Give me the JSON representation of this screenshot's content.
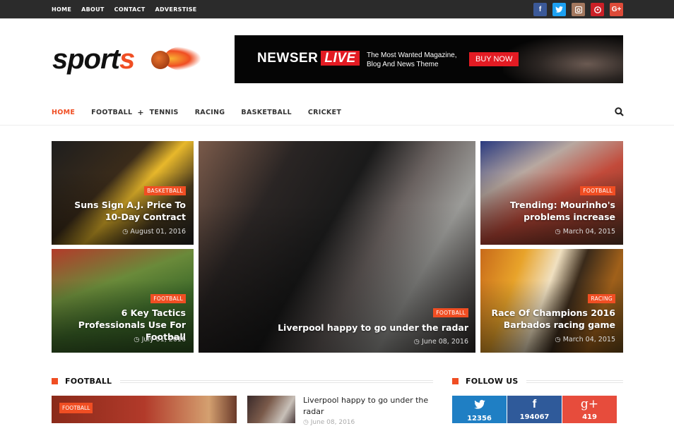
{
  "topbar": {
    "links": [
      "HOME",
      "ABOUT",
      "CONTACT",
      "ADVERSTISE"
    ],
    "social": [
      {
        "name": "facebook",
        "glyph": "f",
        "color": "#3b5998"
      },
      {
        "name": "twitter",
        "glyph": "t",
        "color": "#1da1f2"
      },
      {
        "name": "instagram",
        "glyph": "◘",
        "color": "#a3785f"
      },
      {
        "name": "pinterest",
        "glyph": "P",
        "color": "#cb2027"
      },
      {
        "name": "google-plus",
        "glyph": "G+",
        "color": "#dd4b39"
      }
    ]
  },
  "logo": {
    "text_main": "sport",
    "text_accent": "s"
  },
  "banner": {
    "brand": "NEWSER",
    "brand_accent": "LIVE",
    "tagline_1": "The Most Wanted Magazine,",
    "tagline_2": "Blog And News Theme",
    "cta": "BUY NOW"
  },
  "mainnav": {
    "items": [
      "HOME",
      "FOOTBALL",
      "TENNIS",
      "RACING",
      "BASKETBALL",
      "CRICKET"
    ],
    "active": "HOME",
    "submenu_indicator": "+"
  },
  "featured": [
    {
      "category": "BASKETBALL",
      "title": "Suns Sign A.J. Price To 10-Day Contract",
      "date": "August 01, 2016"
    },
    {
      "category": "FOOTBALL",
      "title": "6 Key Tactics Professionals Use For Football",
      "date": "July 01, 2016"
    },
    {
      "category": "FOOTBALL",
      "title": "Liverpool happy to go under the radar",
      "date": "June 08, 2016"
    },
    {
      "category": "FOOTBALL",
      "title": "Trending: Mourinho's problems increase",
      "date": "March 04, 2015"
    },
    {
      "category": "RACING",
      "title": "Race Of Champions 2016 Barbados racing game",
      "date": "March 04, 2015"
    }
  ],
  "football_section": {
    "title": "FOOTBALL",
    "big_post_category": "FOOTBALL",
    "list": [
      {
        "title": "Liverpool happy to go under the radar",
        "date": "June 08, 2016"
      }
    ]
  },
  "follow_section": {
    "title": "FOLLOW US",
    "networks": [
      {
        "name": "twitter",
        "glyph": "🐦",
        "count": "12356",
        "color": "#1f7fc4"
      },
      {
        "name": "facebook",
        "glyph": "f",
        "count": "194067",
        "color": "#2f5a9a"
      },
      {
        "name": "google-plus",
        "glyph": "g+",
        "count": "419",
        "color": "#e74c3c"
      }
    ]
  },
  "colors": {
    "accent": "#f04e23",
    "topbar": "#2b2b2b"
  }
}
